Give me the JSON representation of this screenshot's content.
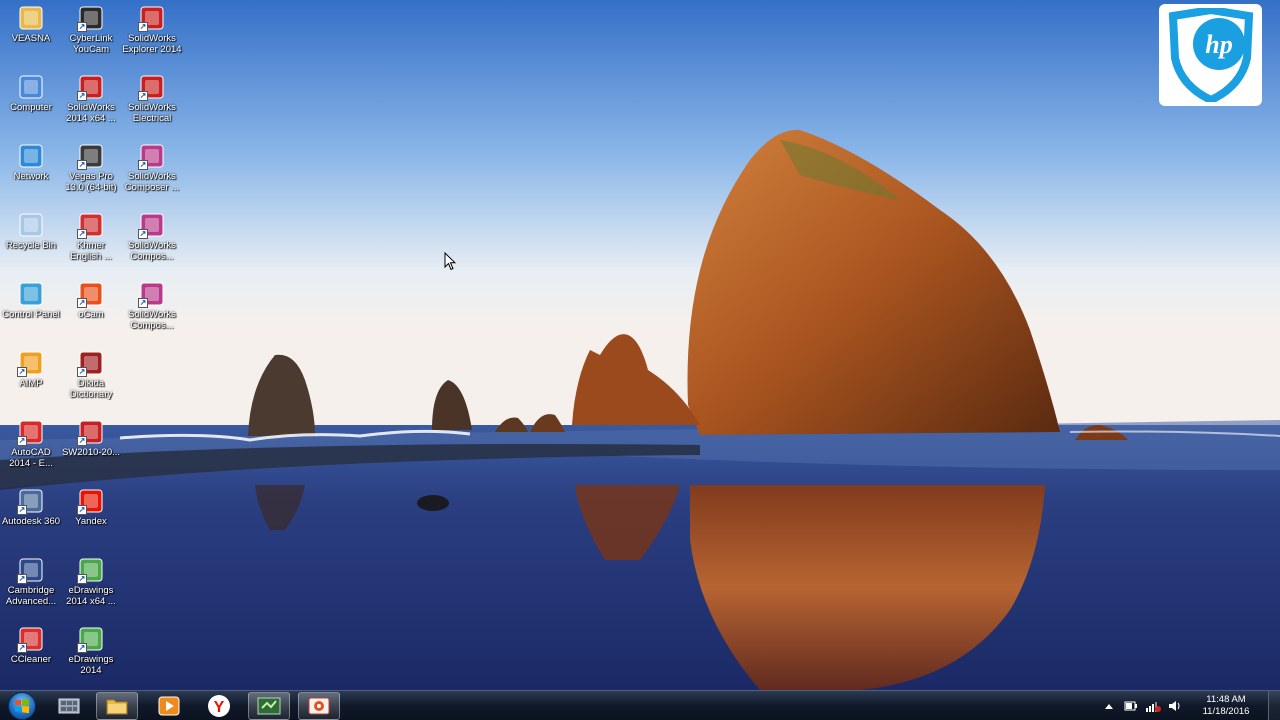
{
  "desktop": {
    "icons": [
      {
        "label": "VEASNA",
        "icon": "folder-icon"
      },
      {
        "label": "Computer",
        "icon": "computer-icon"
      },
      {
        "label": "Network",
        "icon": "network-icon"
      },
      {
        "label": "Recycle Bin",
        "icon": "recycle-bin-icon"
      },
      {
        "label": "Control Panel",
        "icon": "control-panel-icon"
      },
      {
        "label": "AIMP",
        "icon": "aimp-icon"
      },
      {
        "label": "AutoCAD\n2014 - E...",
        "icon": "autocad-icon"
      },
      {
        "label": "Autodesk 360",
        "icon": "autodesk-360-icon"
      },
      {
        "label": "Cambridge\nAdvanced...",
        "icon": "cambridge-dictionary-icon"
      },
      {
        "label": "CCleaner",
        "icon": "ccleaner-icon"
      },
      {
        "label": "CyberLink\nYouCam",
        "icon": "youcam-icon"
      },
      {
        "label": "SolidWorks\n2014 x64 ...",
        "icon": "solidworks-icon"
      },
      {
        "label": "Vegas Pro\n13.0 (64-bit)",
        "icon": "vegas-pro-icon"
      },
      {
        "label": "Khmer\nEnglish ...",
        "icon": "khmer-dictionary-icon"
      },
      {
        "label": "oCam",
        "icon": "ocam-icon"
      },
      {
        "label": "Dikida\nDictionary",
        "icon": "dikida-dictionary-icon"
      },
      {
        "label": "SW2010-20...",
        "icon": "sw2010-icon"
      },
      {
        "label": "Yandex",
        "icon": "yandex-icon"
      },
      {
        "label": "eDrawings\n2014 x64 ...",
        "icon": "edrawings-icon"
      },
      {
        "label": "eDrawings\n2014",
        "icon": "edrawings-icon"
      },
      {
        "label": "SolidWorks\nExplorer 2014",
        "icon": "solidworks-explorer-icon"
      },
      {
        "label": "SolidWorks\nElectrical",
        "icon": "solidworks-electrical-icon"
      },
      {
        "label": "SolidWorks\nComposer ...",
        "icon": "solidworks-composer-icon"
      },
      {
        "label": "SolidWorks\nCompos...",
        "icon": "solidworks-composer-icon"
      },
      {
        "label": "SolidWorks\nCompos...",
        "icon": "solidworks-composer-icon"
      }
    ]
  },
  "taskbar": {
    "pinned": [
      {
        "name": "show-desktop-app",
        "icon": "grid-icon",
        "active": false
      },
      {
        "name": "file-explorer",
        "icon": "folder-icon",
        "active": true
      },
      {
        "name": "media-player",
        "icon": "media-player-icon",
        "active": false
      },
      {
        "name": "yandex-browser",
        "icon": "yandex-icon",
        "active": false
      },
      {
        "name": "camtasia",
        "icon": "recorder-icon",
        "active": true
      },
      {
        "name": "ocam",
        "icon": "ocam-icon",
        "active": true
      }
    ],
    "tray": {
      "icons": [
        "show-hidden-icon",
        "power-icon",
        "network-signal-icon",
        "volume-icon"
      ],
      "time": "11:48 AM",
      "date": "11/18/2016"
    }
  },
  "colors": {
    "sky_top": "#3a78d0",
    "sky_bottom": "#f4f0ec",
    "rock": "#b5602a",
    "taskbar": "#111a2a",
    "hp_blue": "#1aa0e0"
  }
}
